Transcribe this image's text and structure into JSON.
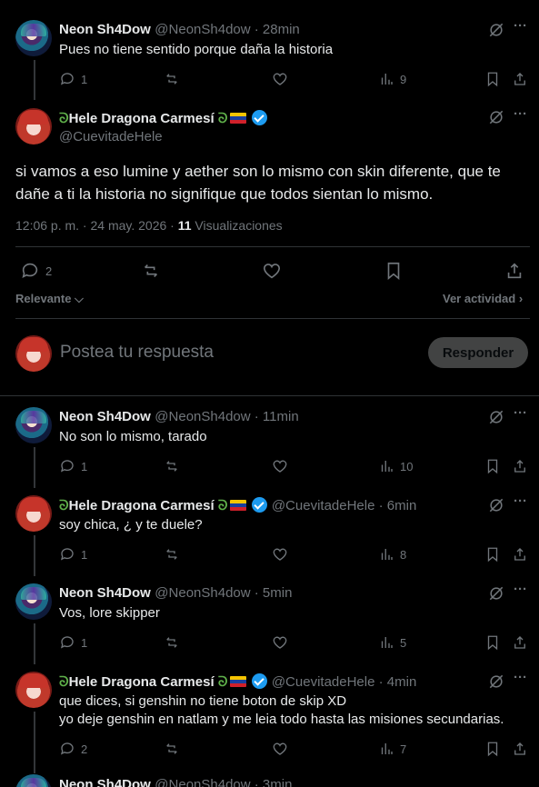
{
  "top_reply": {
    "name": "Neon Sh4Dow",
    "meta": "@NeonSh4dow · 28min",
    "text": "Pues no tiene sentido porque daña la historia",
    "replies": "1",
    "views": "9"
  },
  "main_post": {
    "name_prefix": "ᘐ",
    "name": "Hele Dragona Carmesí",
    "name_suffix": "ᘐ",
    "handle": "@CuevitadeHele",
    "text_line1": "si vamos a eso lumine y aether son lo mismo con skin diferente, que te",
    "text_line2": "dañe a ti la historia no signifique que todos sientan lo mismo.",
    "timestamp": "12:06 p. m. · 24 may. 2026 · ",
    "views_count": "11",
    "views_label": "Visualizaciones",
    "replies": "2"
  },
  "filters": {
    "sort_label": "Relevante",
    "activity_label": "Ver actividad"
  },
  "composer": {
    "placeholder": "Postea tu respuesta",
    "button_label": "Responder"
  },
  "replies": [
    {
      "name": "Neon Sh4Dow",
      "meta": "@NeonSh4dow · 11min",
      "text": "No son lo mismo, tarado",
      "replies": "1",
      "views": "10"
    },
    {
      "name": "Hele Dragona Carmesí",
      "meta": "@CuevitadeHele · 6min",
      "text": "soy chica, ¿ y te duele?",
      "replies": "1",
      "views": "8"
    },
    {
      "name": "Neon Sh4Dow",
      "meta": "@NeonSh4dow · 5min",
      "text": "Vos, lore skipper",
      "replies": "1",
      "views": "5"
    },
    {
      "name": "Hele Dragona Carmesí",
      "meta": "@CuevitadeHele · 4min",
      "text_line1": "que dices, si genshin no tiene boton de skip XD",
      "text_line2": "yo deje genshin en natlam y me leia todo hasta las misiones secundarias.",
      "replies": "2",
      "views": "7"
    },
    {
      "name": "Neon Sh4Dow",
      "meta": "@NeonSh4dow · 3min"
    }
  ],
  "icons": [
    "grok-icon",
    "more-icon",
    "reply-icon",
    "repost-icon",
    "like-icon",
    "views-icon",
    "bookmark-icon",
    "share-icon",
    "chevron-down-icon",
    "chevron-right-icon",
    "verified-icon",
    "flag-venezuela-icon"
  ],
  "colors": {
    "background": "#000000",
    "text": "#e7e9ea",
    "muted": "#71767b",
    "divider": "#2f3336",
    "accent": "#1d9bf0"
  }
}
